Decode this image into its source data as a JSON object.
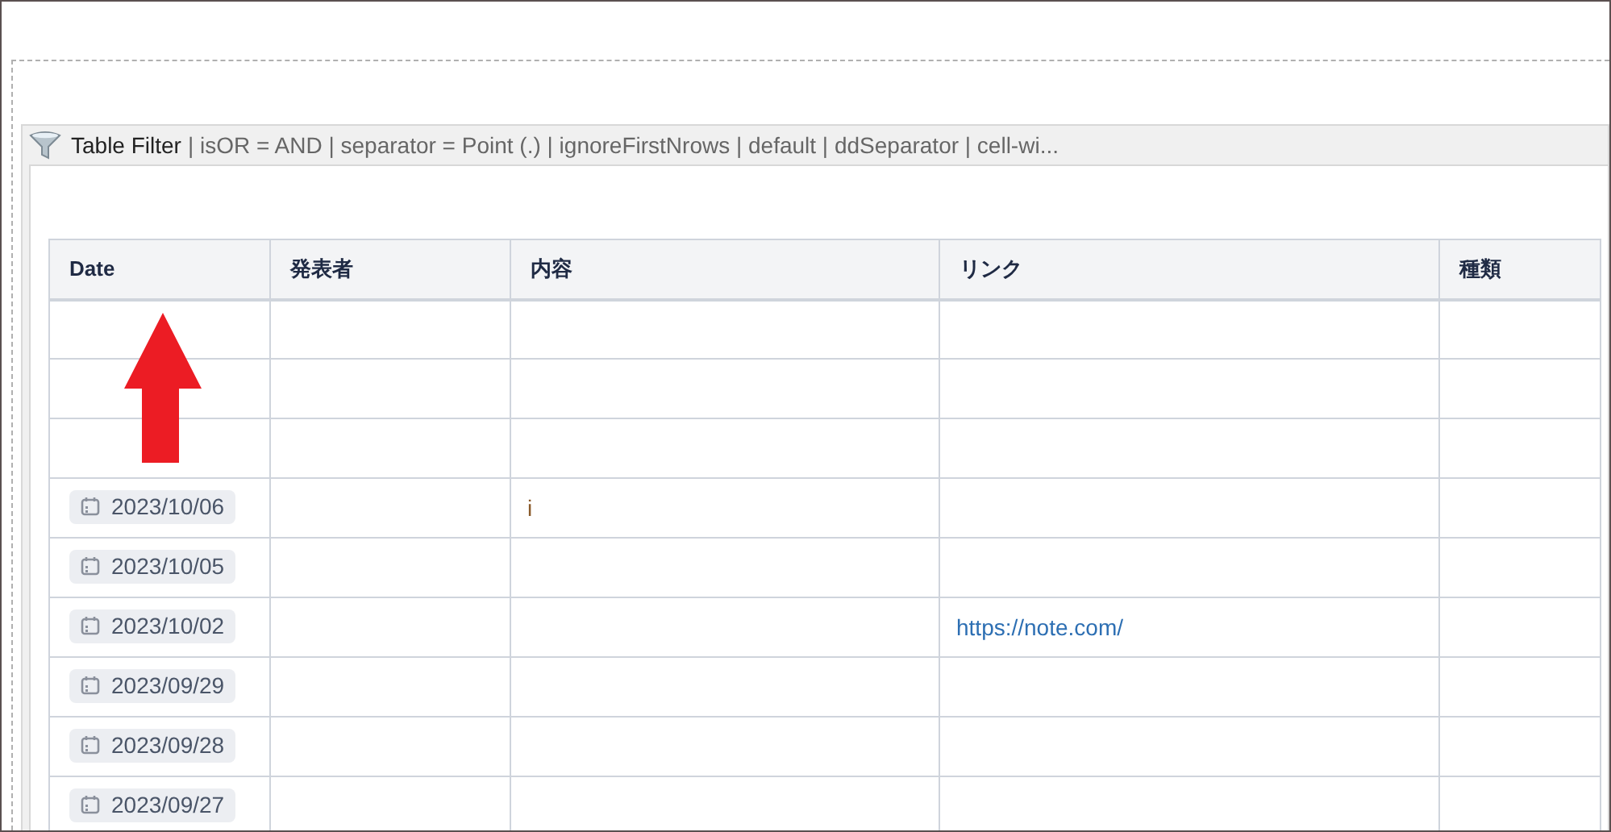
{
  "panel": {
    "title": "Table Filter",
    "settings": "| isOR = AND | separator = Point (.) | ignoreFirstNrows | default | ddSeparator | cell-wi..."
  },
  "table": {
    "columns": [
      "Date",
      "発表者",
      "内容",
      "リンク",
      "種類"
    ],
    "rows": [
      {
        "date": "",
        "content": "",
        "link": ""
      },
      {
        "date": "",
        "content": "",
        "link": ""
      },
      {
        "date": "",
        "content": "",
        "link": ""
      },
      {
        "date": "2023/10/06",
        "content": "i",
        "link": ""
      },
      {
        "date": "2023/10/05",
        "content": "",
        "link": ""
      },
      {
        "date": "2023/10/02",
        "content": "",
        "link": "https://note.com/"
      },
      {
        "date": "2023/09/29",
        "content": "",
        "link": ""
      },
      {
        "date": "2023/09/28",
        "content": "",
        "link": ""
      },
      {
        "date": "2023/09/27",
        "content": "",
        "link": ""
      }
    ]
  }
}
